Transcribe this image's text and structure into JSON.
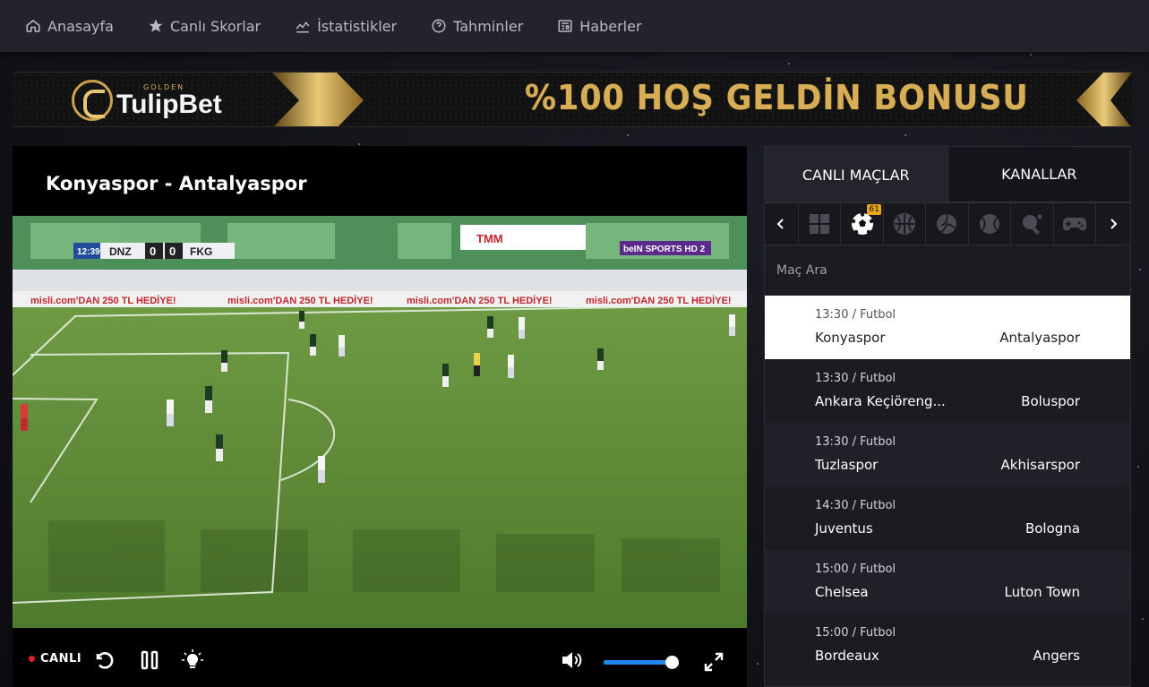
{
  "nav": {
    "items": [
      {
        "label": "Anasayfa",
        "icon": "home-icon"
      },
      {
        "label": "Canlı Skorlar",
        "icon": "star-icon"
      },
      {
        "label": "İstatistikler",
        "icon": "chart-icon"
      },
      {
        "label": "Tahminler",
        "icon": "help-circle-icon"
      },
      {
        "label": "Haberler",
        "icon": "newspaper-icon"
      }
    ]
  },
  "banner": {
    "logo_small": "GOLDEN",
    "logo_main": "TulipBet",
    "headline": "%100 HOŞ GELDİN BONUSU"
  },
  "player": {
    "title": "Konyaspor - Antalyaspor",
    "live_label": "CANLI",
    "volume_fraction": 0.95,
    "scorebug": {
      "clock": "12:39",
      "home": "DNZ",
      "home_score": "0",
      "away_score": "0",
      "away": "FKG",
      "channel": "beIN SPORTS HD 2"
    },
    "ad_board": "misli.com'DAN 250 TL HEDİYE!",
    "stadium_board": "TMM"
  },
  "side": {
    "tabs": [
      "CANLI MAÇLAR",
      "KANALLAR"
    ],
    "sports_badge": "61",
    "search_placeholder": "Maç Ara",
    "matches": [
      {
        "time": "13:30",
        "sport": "Futbol",
        "home": "Konyaspor",
        "away": "Antalyaspor"
      },
      {
        "time": "13:30",
        "sport": "Futbol",
        "home": "Ankara Keçiöreng...",
        "away": "Boluspor"
      },
      {
        "time": "13:30",
        "sport": "Futbol",
        "home": "Tuzlaspor",
        "away": "Akhisarspor"
      },
      {
        "time": "14:30",
        "sport": "Futbol",
        "home": "Juventus",
        "away": "Bologna"
      },
      {
        "time": "15:00",
        "sport": "Futbol",
        "home": "Chelsea",
        "away": "Luton Town"
      },
      {
        "time": "15:00",
        "sport": "Futbol",
        "home": "Bordeaux",
        "away": "Angers"
      }
    ]
  },
  "colors": {
    "accent": "#1e8bf0",
    "live_dot": "#e81f2a",
    "badge": "#e9a515",
    "gold": "#d7ae55"
  }
}
